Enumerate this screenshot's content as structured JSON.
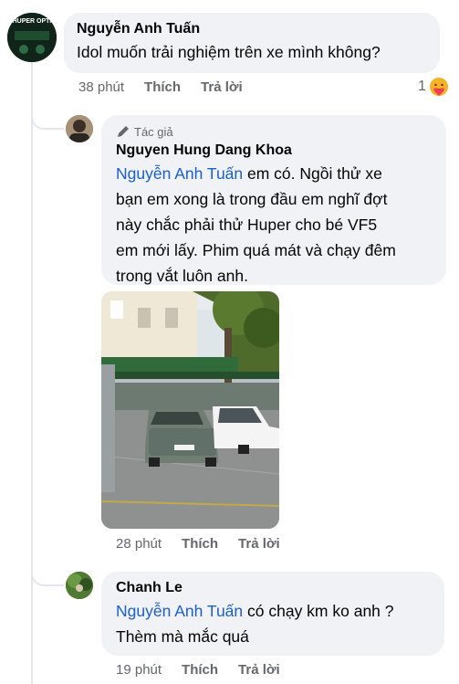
{
  "comments": [
    {
      "author": "Nguyễn Anh Tuấn",
      "avatar_text": "HUPER OPTI",
      "text": "Idol muốn trải nghiệm trên xe mình không?",
      "time": "38 phút",
      "like_label": "Thích",
      "reply_label": "Trả lời",
      "reaction_count": "1",
      "reaction_icon": "care-reaction-icon"
    },
    {
      "badge_label": "Tác giả",
      "author": "Nguyen Hung Dang Khoa",
      "mention": "Nguyễn Anh Tuấn",
      "text_line1": " em có. Ngồi thử xe",
      "text_line2": "bạn em xong là trong đầu em nghĩ đợt",
      "text_line3": "này chắc phải thử Huper cho bé VF5",
      "text_line4": "em mới lấy. Phim quá mát và chạy đêm",
      "text_line5": "trong vắt luôn anh.",
      "time": "28 phút",
      "like_label": "Thích",
      "reply_label": "Trả lời"
    },
    {
      "author": "Chanh Le",
      "mention": "Nguyễn Anh Tuấn",
      "text_line1": " có chạy km ko anh ?",
      "text_line2": "Thèm mà mắc quá",
      "time": "19 phút",
      "like_label": "Thích",
      "reply_label": "Trả lời"
    }
  ],
  "colors": {
    "bubble": "#f0f2f5",
    "mention": "#1b5fc7",
    "meta": "#65676b"
  }
}
